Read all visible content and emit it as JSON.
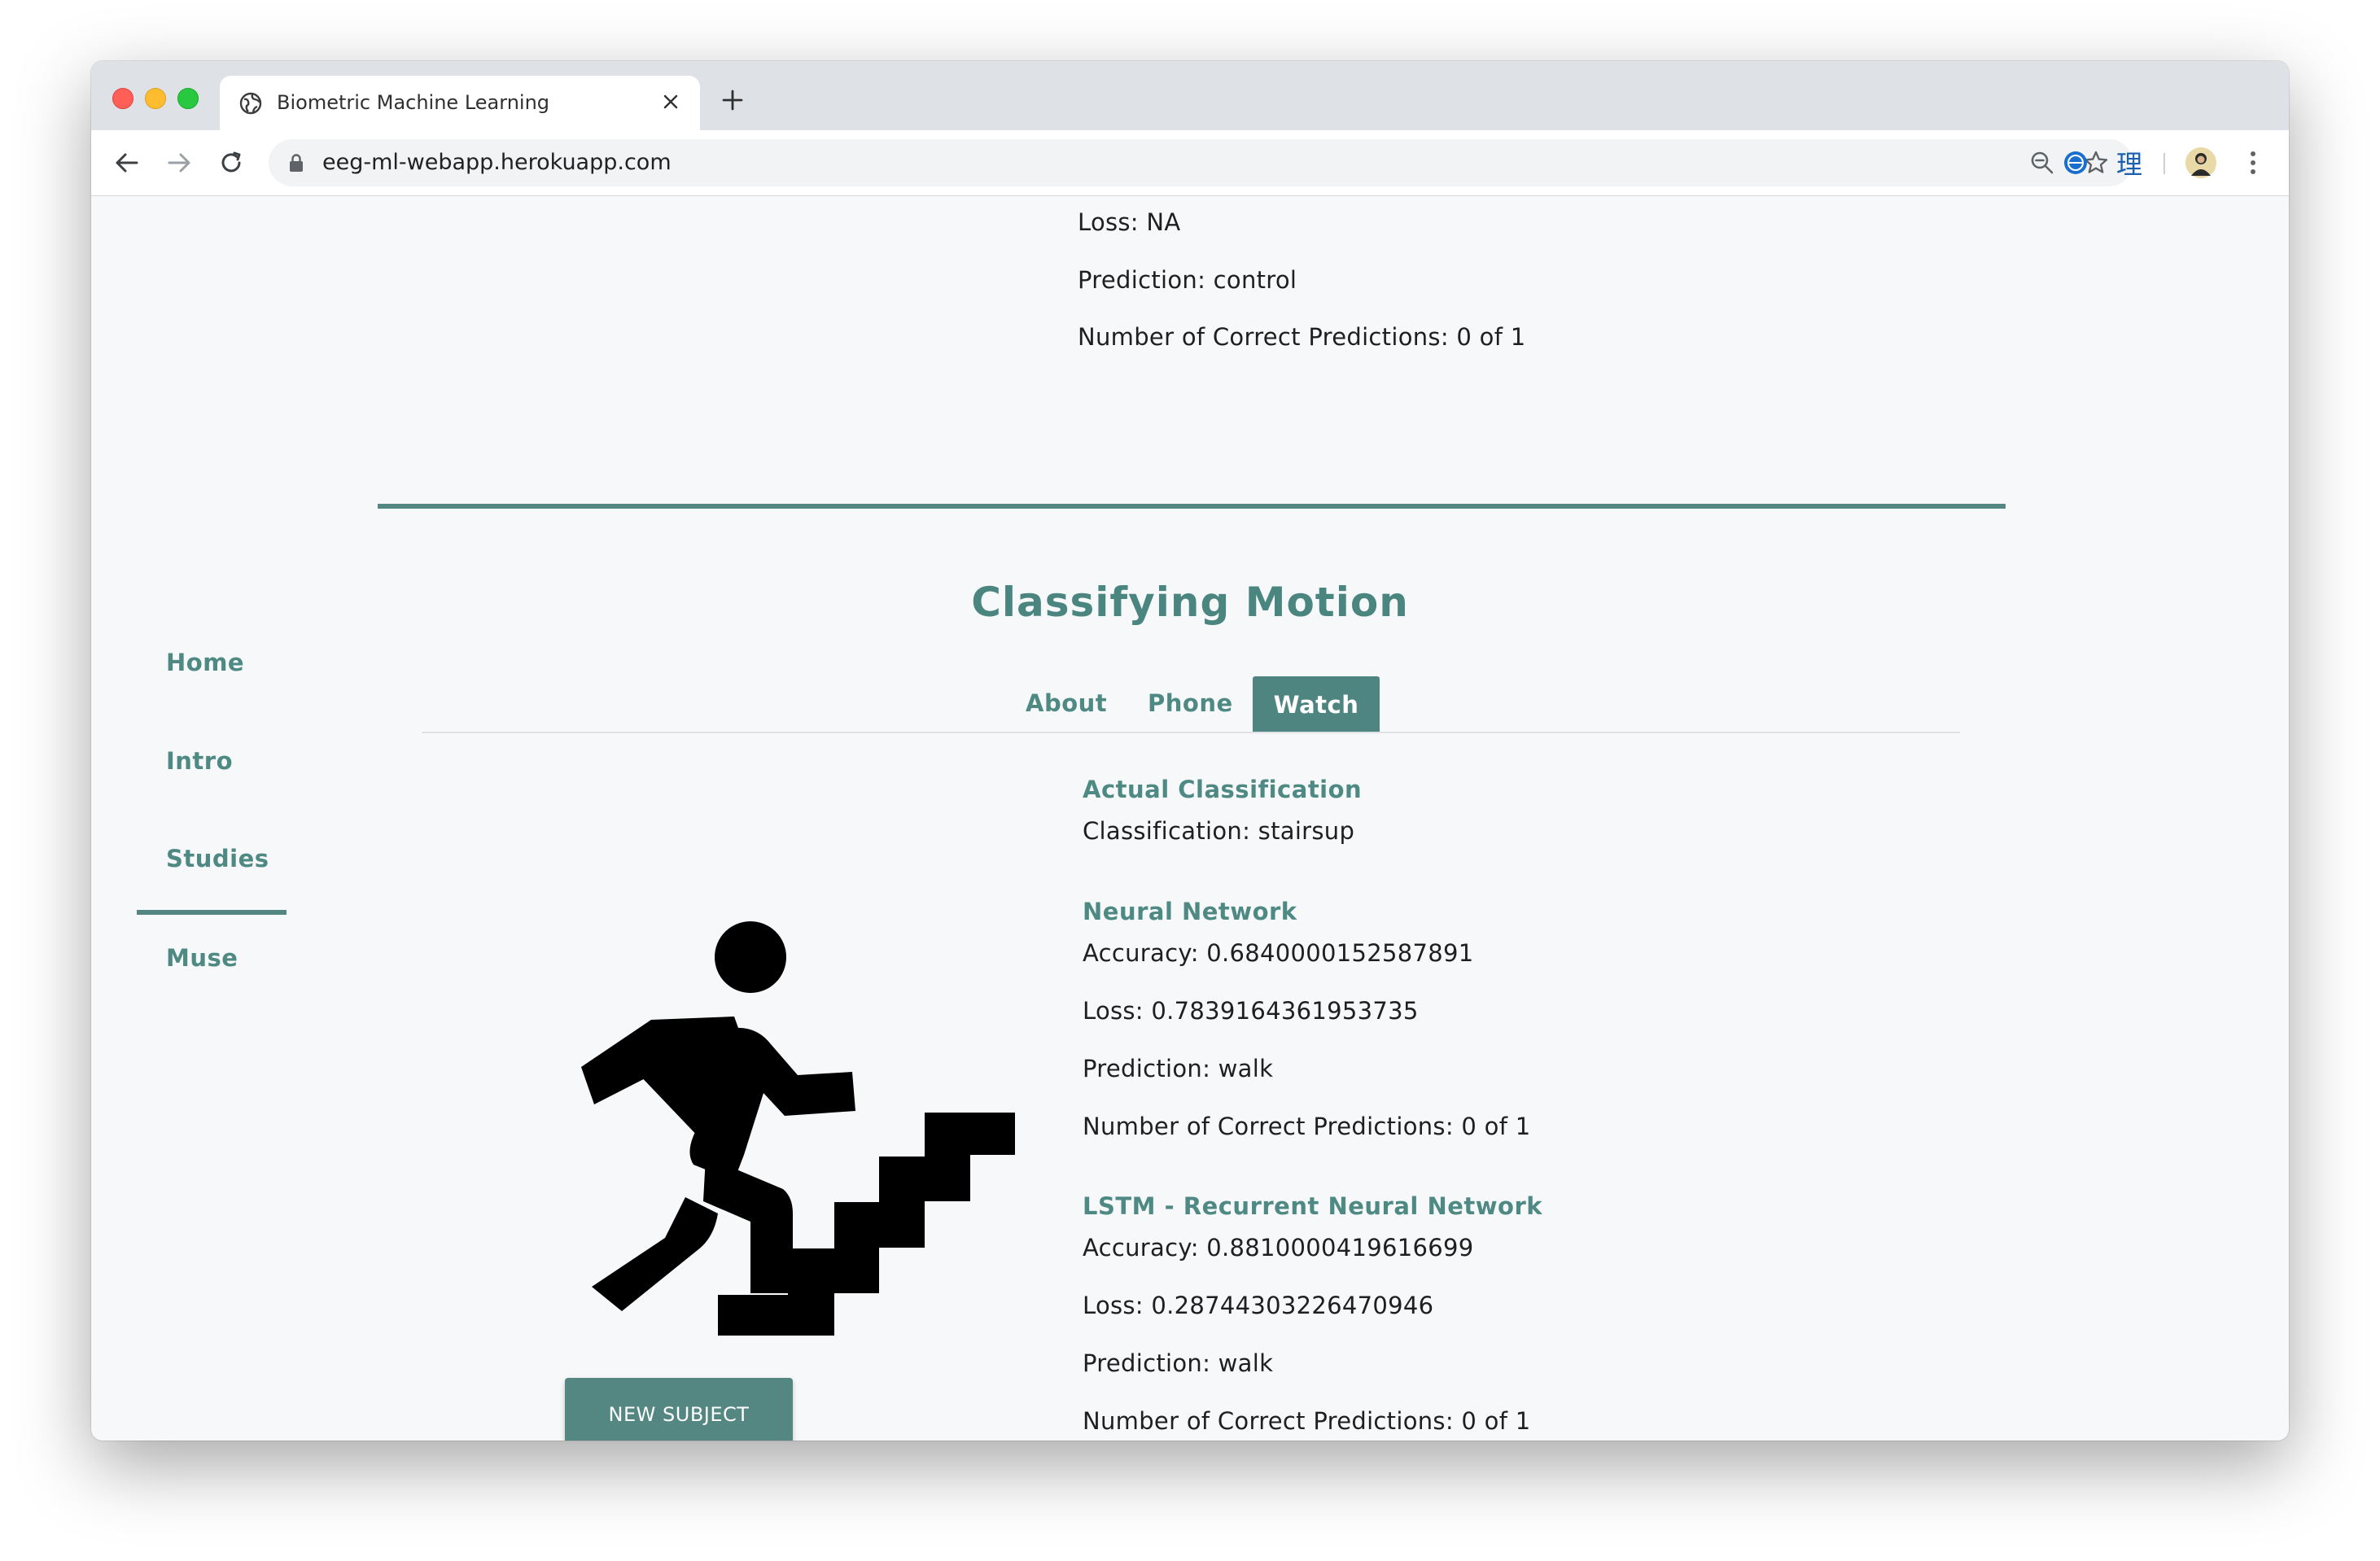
{
  "browser": {
    "tab_title": "Biometric Machine Learning",
    "url": "eeg-ml-webapp.herokuapp.com",
    "icons": [
      "globe-icon",
      "close-icon",
      "plus-icon",
      "back-arrow-icon",
      "forward-arrow-icon",
      "reload-icon",
      "lock-icon",
      "zoom-icon",
      "star-icon",
      "translate-extension-icon",
      "dictionary-extension-icon",
      "profile-avatar-icon",
      "menu-kebab-icon"
    ],
    "ext_glyph": "理"
  },
  "previous_model": {
    "loss": "Loss: NA",
    "prediction": "Prediction: control",
    "correct": "Number of Correct Predictions: 0 of 1"
  },
  "sidenav": {
    "items": [
      "Home",
      "Intro",
      "Studies",
      "Muse"
    ],
    "active": "Studies"
  },
  "section": {
    "title": "Classifying Motion",
    "tabs": [
      "About",
      "Phone",
      "Watch"
    ],
    "active_tab": "Watch"
  },
  "actual": {
    "heading": "Actual Classification",
    "value": "Classification: stairsup"
  },
  "neural_network": {
    "heading": "Neural Network",
    "accuracy": "Accuracy: 0.6840000152587891",
    "loss": "Loss: 0.7839164361953735",
    "prediction": "Prediction: walk",
    "correct": "Number of Correct Predictions: 0 of 1"
  },
  "lstm": {
    "heading": "LSTM - Recurrent Neural Network",
    "accuracy": "Accuracy: 0.8810000419616699",
    "loss": "Loss: 0.28744303226470946",
    "prediction": "Prediction: walk",
    "correct": "Number of Correct Predictions: 0 of 1"
  },
  "button": {
    "new_subject": "NEW SUBJECT"
  },
  "colors": {
    "accent": "#558782",
    "accent_text": "#4e8983",
    "page_bg": "#f6f8f9"
  }
}
